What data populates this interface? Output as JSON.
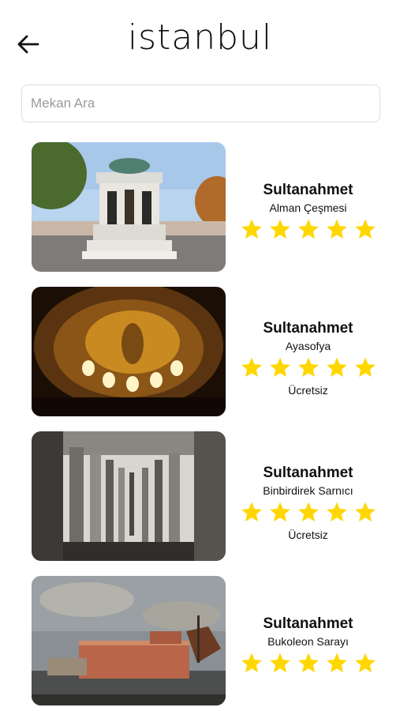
{
  "header": {
    "title": "istanbul",
    "back_icon": "arrow-left-icon"
  },
  "search": {
    "placeholder": "Mekan Ara",
    "value": ""
  },
  "colors": {
    "star": "#FFD700"
  },
  "places": [
    {
      "district": "Sultanahmet",
      "name": "Alman Çeşmesi",
      "rating": 5,
      "price": "",
      "image": "german-fountain-photo"
    },
    {
      "district": "Sultanahmet",
      "name": "Ayasofya",
      "rating": 5,
      "price": "Ücretsiz",
      "image": "hagia-sophia-dome-photo"
    },
    {
      "district": "Sultanahmet",
      "name": "Binbirdirek Sarnıcı",
      "rating": 5,
      "price": "Ücretsiz",
      "image": "cistern-columns-photo"
    },
    {
      "district": "Sultanahmet",
      "name": "Bukoleon Sarayı",
      "rating": 5,
      "price": "",
      "image": "bukoleon-palace-painting"
    }
  ]
}
